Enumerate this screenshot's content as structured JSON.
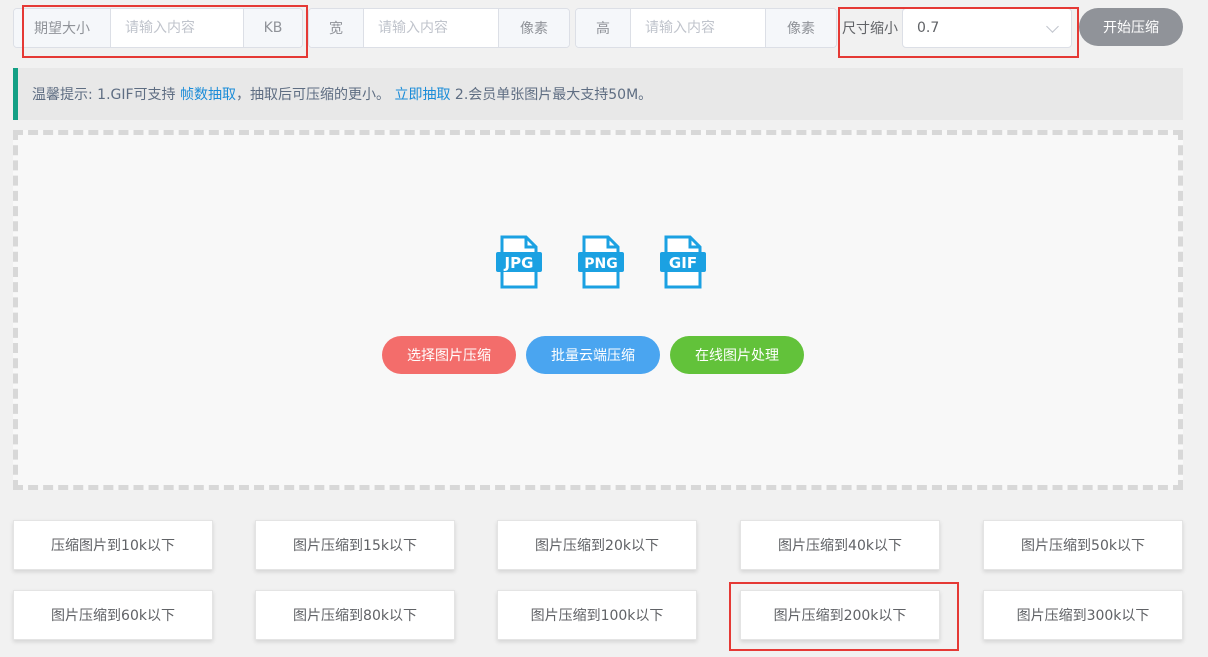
{
  "toolbar": {
    "size": {
      "prefix": "期望大小",
      "placeholder": "请输入内容",
      "suffix": "KB"
    },
    "width": {
      "prefix": "宽",
      "placeholder": "请输入内容",
      "suffix": "像素"
    },
    "height": {
      "prefix": "高",
      "placeholder": "请输入内容",
      "suffix": "像素"
    },
    "scale": {
      "label": "尺寸缩小",
      "value": "0.7"
    },
    "start_button": "开始压缩"
  },
  "tip": {
    "prefix": "温馨提示: 1.GIF可支持 ",
    "link1": "帧数抽取",
    "middle": "，抽取后可压缩的更小。 ",
    "link2": "立即抽取",
    "suffix": " 2.会员单张图片最大支持50M。"
  },
  "dropzone": {
    "file_types": [
      "JPG",
      "PNG",
      "GIF"
    ],
    "buttons": {
      "select": "选择图片压缩",
      "batch": "批量云端压缩",
      "online": "在线图片处理"
    }
  },
  "presets": [
    "压缩图片到10k以下",
    "图片压缩到15k以下",
    "图片压缩到20k以下",
    "图片压缩到40k以下",
    "图片压缩到50k以下",
    "图片压缩到60k以下",
    "图片压缩到80k以下",
    "图片压缩到100k以下",
    "图片压缩到200k以下",
    "图片压缩到300k以下"
  ],
  "colors": {
    "highlight": "#e53935",
    "tip_accent": "#14a085",
    "link": "#1a8cd8",
    "file_icon": "#1ba1e2",
    "select_button": "#f36d6b",
    "batch_button": "#4aa5f0",
    "online_button": "#62c23a",
    "start_button": "#909399"
  }
}
